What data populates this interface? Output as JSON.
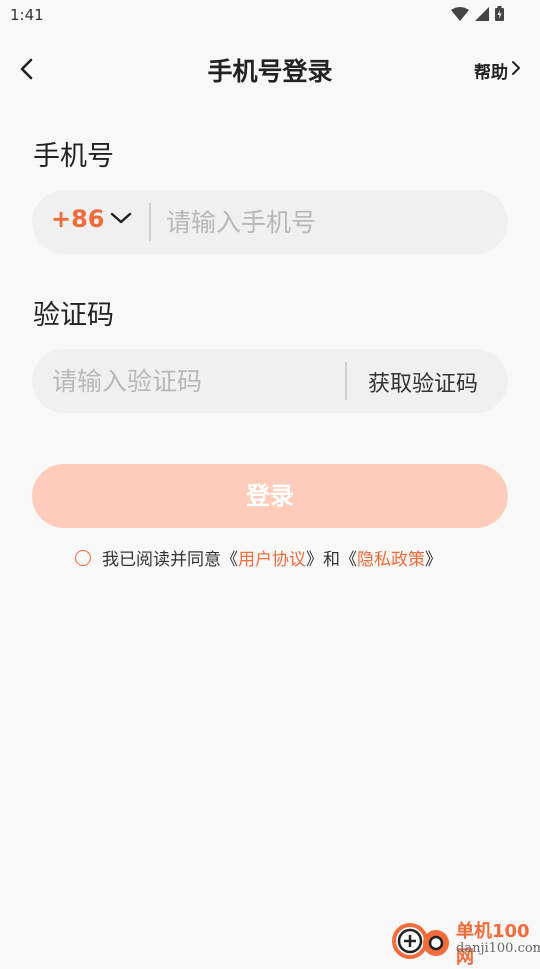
{
  "status_bar": {
    "time": "1:41"
  },
  "nav": {
    "title": "手机号登录",
    "help_label": "帮助"
  },
  "phone": {
    "label": "手机号",
    "country_code": "+86",
    "placeholder": "请输入手机号",
    "value": ""
  },
  "code": {
    "label": "验证码",
    "placeholder": "请输入验证码",
    "value": "",
    "get_code_label": "获取验证码"
  },
  "login": {
    "label": "登录"
  },
  "agreement": {
    "checked": false,
    "prefix": "我已阅读并同意《",
    "user_agreement": "用户协议",
    "middle": "》和《",
    "privacy_policy": "隐私政策",
    "suffix": "》"
  },
  "watermark": {
    "brand": "单机100网",
    "url": "danji100.com"
  },
  "colors": {
    "accent": "#f26b3a",
    "button_disabled": "#ffccbc",
    "field_bg": "#f0f0f0",
    "page_bg": "#f8f8f8"
  },
  "icons": {
    "back": "chevron-left-icon",
    "help": "chevron-right-icon",
    "country_dropdown": "chevron-down-icon",
    "checkbox": "circle-checkbox-icon",
    "status": [
      "wifi-icon",
      "signal-icon",
      "battery-icon"
    ]
  }
}
